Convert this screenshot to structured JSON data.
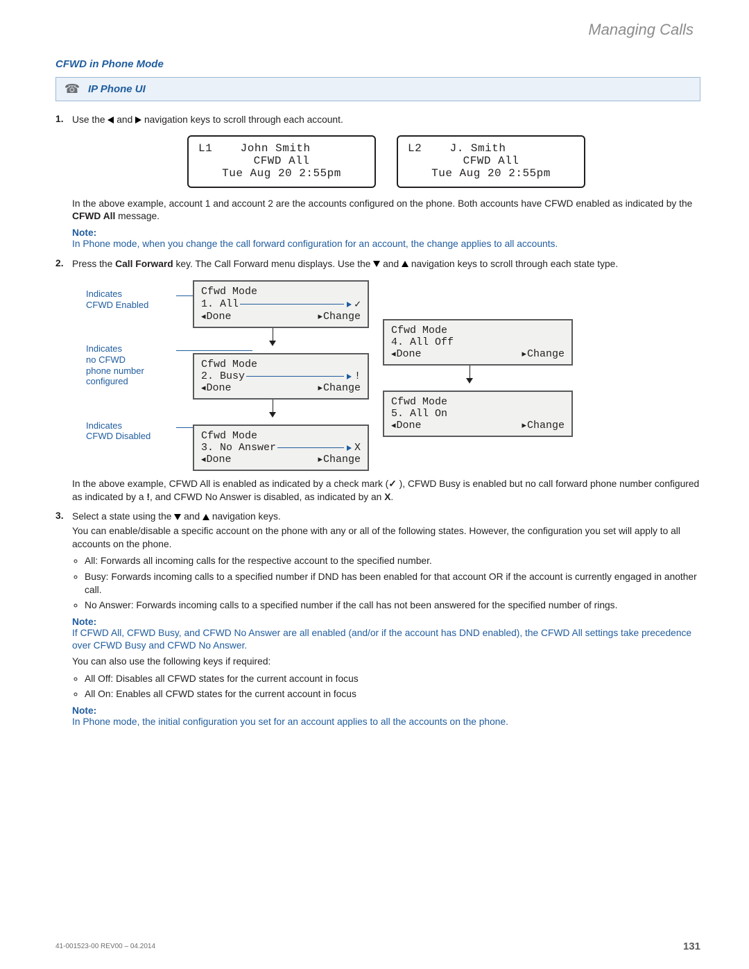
{
  "header": {
    "running_title": "Managing Calls"
  },
  "section": {
    "title": "CFWD in Phone Mode"
  },
  "callout": {
    "title": "IP Phone UI"
  },
  "step1": {
    "pre": "Use the ",
    "mid": " and ",
    "post": " navigation keys to scroll through each account."
  },
  "lcd": {
    "l1": {
      "line1": "L1    John Smith",
      "line2": "CFWD All",
      "line3": "Tue Aug 20 2:55pm"
    },
    "l2": {
      "line1": "L2    J. Smith",
      "line2": "CFWD All",
      "line3": "Tue Aug 20 2:55pm"
    }
  },
  "para1a": "In the above example, account 1 and account 2 are the accounts configured on the phone. Both accounts have CFWD enabled as indicated by the ",
  "para1b": "CFWD All",
  "para1c": " message.",
  "note1": {
    "label": "Note:",
    "text": "In Phone mode, when you change the call forward configuration for an account, the change applies to all accounts."
  },
  "step2": {
    "a": "Press the ",
    "b": "Call Forward",
    "c": " key. The Call Forward menu displays. Use the ",
    "d": " and ",
    "e": " navigation keys to scroll through each state type."
  },
  "diag": {
    "labels": {
      "enabled": "Indicates\nCFWD Enabled",
      "no_num": "Indicates\nno CFWD\nphone number\nconfigured",
      "disabled": "Indicates\nCFWD Disabled"
    },
    "screens": {
      "hdr": "Cfwd Mode",
      "s1": {
        "state": "1. All",
        "mark": "✓"
      },
      "s2": {
        "state": "2. Busy",
        "mark": "!"
      },
      "s3": {
        "state": "3. No Answer",
        "mark": "X"
      },
      "s4": {
        "state": "4. All Off",
        "mark": ""
      },
      "s5": {
        "state": "5. All On",
        "mark": ""
      },
      "done": "Done",
      "change": "Change"
    }
  },
  "para2": {
    "a": "In the above example, CFWD All is enabled as indicated by a check mark (",
    "b": "✓",
    "c": " ), CFWD Busy is enabled but no call forward phone number configured as indicated by a ",
    "d": "!",
    "e": ", and CFWD No Answer is disabled, as indicated by an ",
    "f": "X",
    "g": "."
  },
  "step3": {
    "a": "Select a state using the ",
    "b": " and ",
    "c": " navigation keys.",
    "d": "You can enable/disable a specific account on the phone with any or all of the following states. However, the configuration you set will apply to all accounts on the phone."
  },
  "bullets1": {
    "i1": "All: Forwards all incoming calls for the respective account to the specified number.",
    "i2": "Busy: Forwards incoming calls to a specified number if DND has been enabled for that account OR if the account is currently engaged in another call.",
    "i3": "No Answer: Forwards incoming calls to a specified number if the call has not been answered for the specified number of rings."
  },
  "note2": {
    "label": "Note:",
    "text": "If CFWD All, CFWD Busy, and CFWD No Answer are all enabled (and/or if the account has DND enabled), the CFWD All settings take precedence over CFWD Busy and CFWD No Answer."
  },
  "para3": "You can also use the following keys if required:",
  "bullets2": {
    "i1": "All Off: Disables all CFWD states for the current account in focus",
    "i2": "All On: Enables all CFWD states for the current account in focus"
  },
  "note3": {
    "label": "Note:",
    "text": "In Phone mode, the initial configuration you set for an account applies to all the accounts on the phone."
  },
  "footer": {
    "docid": "41-001523-00 REV00 – 04.2014",
    "page": "131"
  }
}
